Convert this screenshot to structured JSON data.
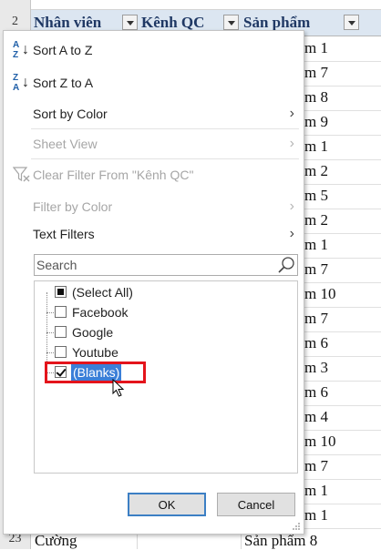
{
  "sheet": {
    "row_numbers": [
      "2",
      "23"
    ],
    "headers": [
      {
        "label": "Nhân viên"
      },
      {
        "label": "Kênh QC"
      },
      {
        "label": "Sản phẩm"
      }
    ],
    "product_cells": [
      "m 1",
      "m 7",
      "m 8",
      "m 9",
      "m 1",
      "m 2",
      "m 5",
      "m 2",
      "m 1",
      "m 7",
      "m 10",
      "m 7",
      "m 6",
      "m 3",
      "m 6",
      "m 4",
      "m 10",
      "m 7",
      "m 1",
      "m 1"
    ],
    "last_row": {
      "name": "Cường",
      "product": "Sản phẩm 8"
    }
  },
  "menu": {
    "sort_az": "Sort A to Z",
    "sort_za": "Sort Z to A",
    "sort_by_color": "Sort by Color",
    "sheet_view": "Sheet View",
    "clear_filter": "Clear Filter From \"Kênh QC\"",
    "filter_by_color": "Filter by Color",
    "text_filters": "Text Filters",
    "submenu_arrow": "›"
  },
  "search": {
    "placeholder": "Search"
  },
  "filter_list": [
    {
      "label": "(Select All)",
      "state": "partial"
    },
    {
      "label": "Facebook",
      "state": "unchecked"
    },
    {
      "label": "Google",
      "state": "unchecked"
    },
    {
      "label": "Youtube",
      "state": "unchecked"
    },
    {
      "label": "(Blanks)",
      "state": "checked"
    }
  ],
  "buttons": {
    "ok": "OK",
    "cancel": "Cancel"
  },
  "colors": {
    "header_fill": "#dce6f1",
    "selection": "#3b7fd8",
    "highlight_box": "#e4141b"
  }
}
